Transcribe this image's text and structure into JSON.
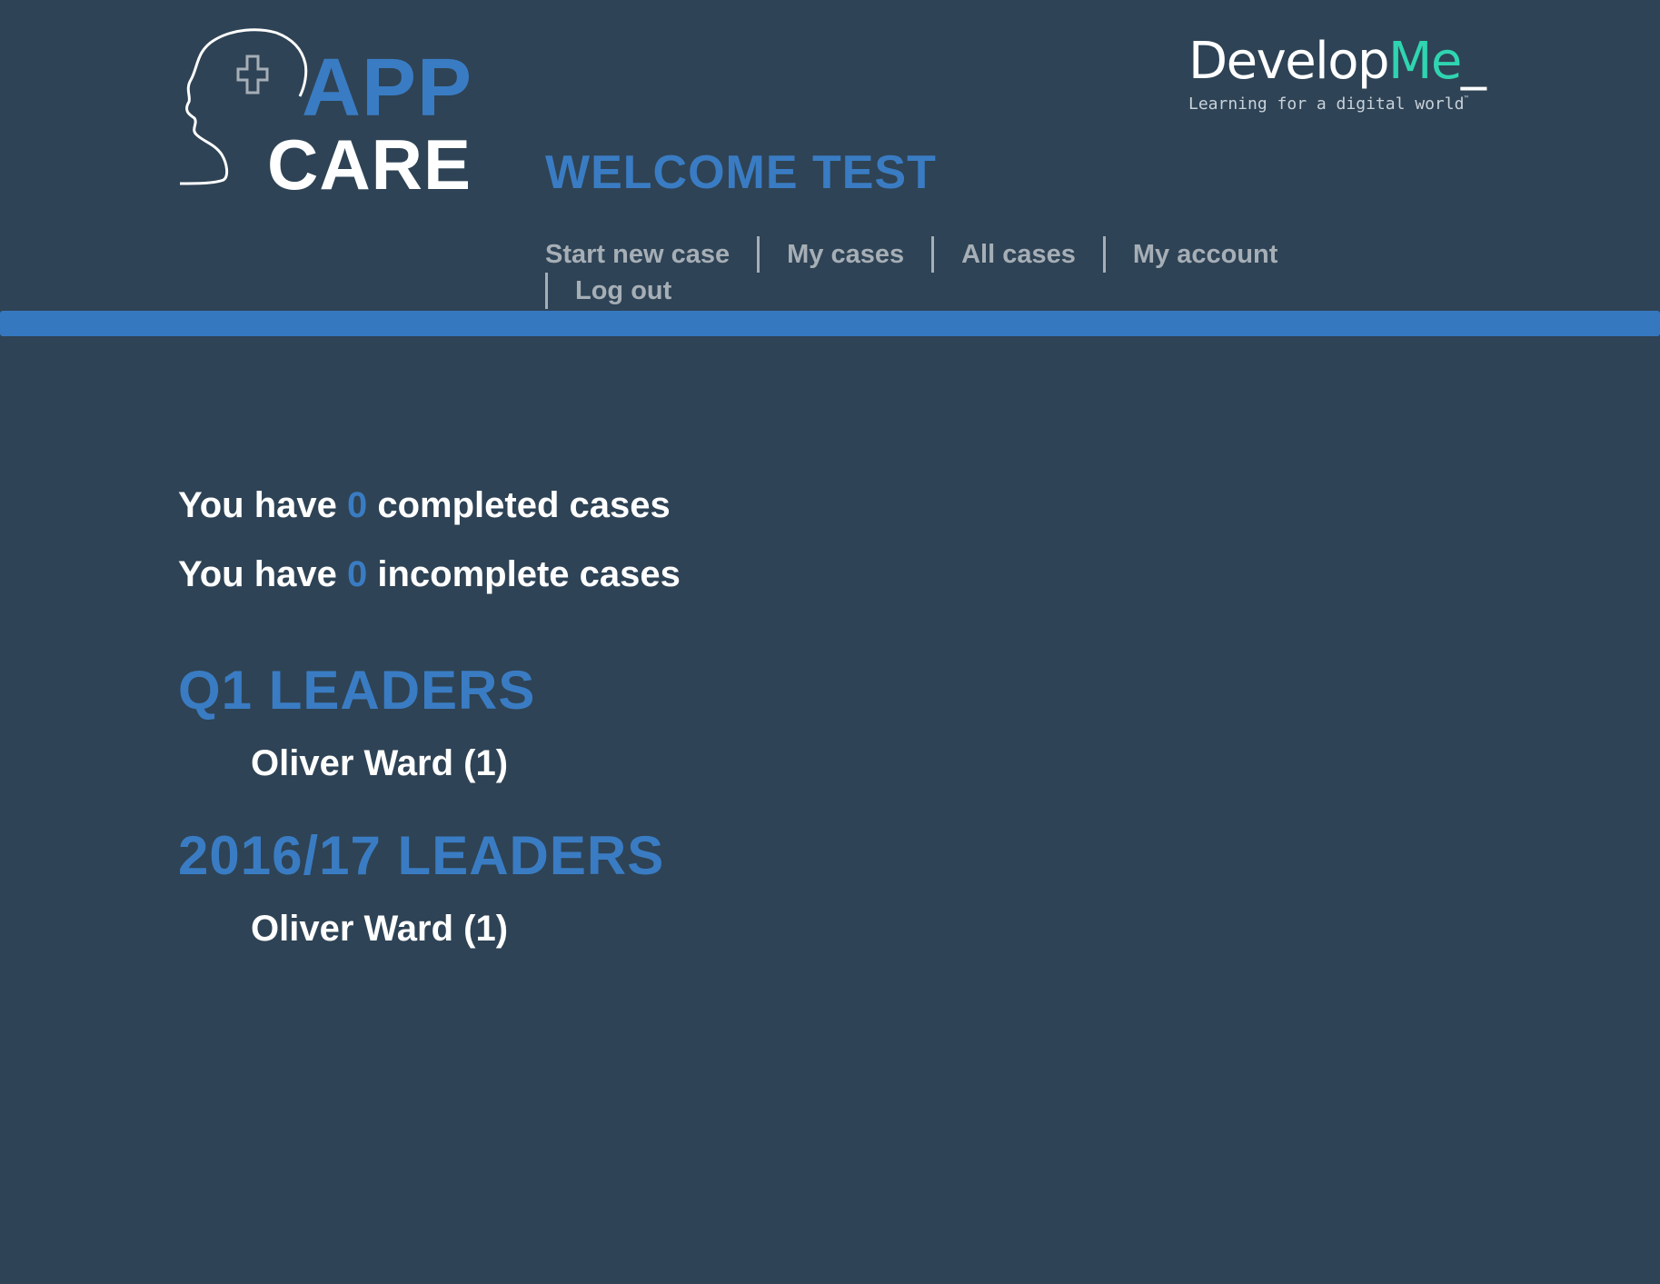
{
  "logo": {
    "app_text": "APP",
    "care_text": "CARE",
    "icon": "head-with-plus-icon"
  },
  "brand": {
    "name_main": "Develop",
    "name_accent": "Me",
    "name_cursor": "_",
    "tagline": "Learning for a digital world",
    "tagline_mark": "™",
    "accent_color": "#2fd4b0"
  },
  "header": {
    "welcome": "WELCOME TEST"
  },
  "nav": {
    "items": [
      {
        "label": "Start new case"
      },
      {
        "label": "My cases"
      },
      {
        "label": "All cases"
      },
      {
        "label": "My account"
      },
      {
        "label": "Log out"
      }
    ]
  },
  "stats": {
    "completed_prefix": "You have",
    "completed_count": "0",
    "completed_suffix": "completed cases",
    "incomplete_prefix": "You have",
    "incomplete_count": "0",
    "incomplete_suffix": "incomplete cases"
  },
  "leaders": {
    "q1": {
      "title": "Q1 LEADERS",
      "entries": [
        "Oliver Ward (1)"
      ]
    },
    "year": {
      "title": "2016/17 LEADERS",
      "entries": [
        "Oliver Ward (1)"
      ]
    }
  },
  "colors": {
    "background": "#2e4355",
    "accent_blue": "#3a7cc3",
    "bar_blue": "#3578c0",
    "nav_gray": "#a6aeb6"
  }
}
